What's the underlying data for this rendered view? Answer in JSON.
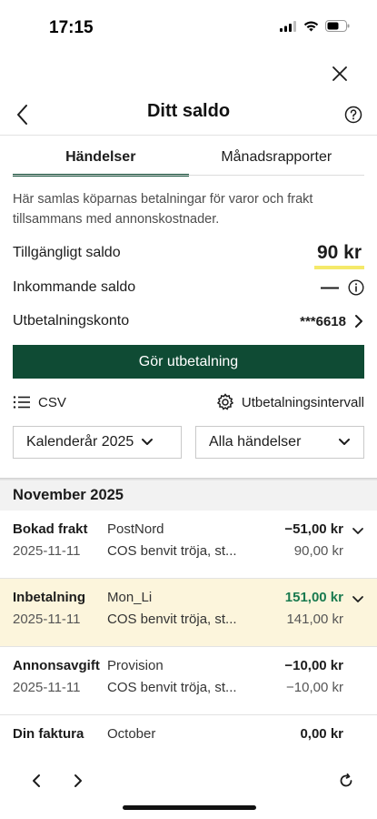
{
  "status_bar": {
    "time": "17:15",
    "icons": [
      "signal-icon",
      "wifi-icon",
      "battery-icon"
    ]
  },
  "header": {
    "title": "Ditt saldo",
    "back_icon": "chevron-left-icon",
    "help_icon": "question-circle-icon",
    "close_icon": "close-icon"
  },
  "tabs": [
    {
      "label": "Händelser",
      "active": true
    },
    {
      "label": "Månadsrapporter",
      "active": false
    }
  ],
  "intro_text": "Här samlas köparnas betalningar för varor och frakt tillsammans med annonskostnader.",
  "balance": {
    "available_label": "Tillgängligt saldo",
    "available_value": "90 kr",
    "incoming_label": "Inkommande saldo",
    "incoming_value": "—",
    "account_label": "Utbetalningskonto",
    "account_value": "***6618"
  },
  "payout_button": "Gör utbetalning",
  "tools": {
    "csv_label": "CSV",
    "interval_label": "Utbetalningsintervall"
  },
  "filters": {
    "year": "Kalenderår 2025",
    "events": "Alla händelser"
  },
  "month": "November 2025",
  "transactions": [
    {
      "type": "Bokad frakt",
      "date": "2025-11-11",
      "party": "PostNord",
      "desc": "COS benvit tröja, st...",
      "amount": "−51,00 kr",
      "sub": "90,00 kr",
      "highlight": false,
      "green": false,
      "chevron": true
    },
    {
      "type": "Inbetalning",
      "date": "2025-11-11",
      "party": "Mon_Li",
      "desc": "COS benvit tröja, st...",
      "amount": "151,00 kr",
      "sub": "141,00 kr",
      "highlight": true,
      "green": true,
      "chevron": true
    },
    {
      "type": "Annonsavgift",
      "date": "2025-11-11",
      "party": "Provision",
      "desc": "COS benvit tröja, st...",
      "amount": "−10,00 kr",
      "sub": "−10,00 kr",
      "highlight": false,
      "green": false,
      "chevron": false
    },
    {
      "type": "Din faktura",
      "date": "",
      "party": "October",
      "desc": "",
      "amount": "0,00 kr",
      "sub": "",
      "highlight": false,
      "green": false,
      "chevron": false
    }
  ],
  "colors": {
    "accent": "#0f4b34",
    "highlight_bg": "#fcf5dc",
    "underline": "#f5e96a",
    "positive": "#1a7a4f"
  }
}
